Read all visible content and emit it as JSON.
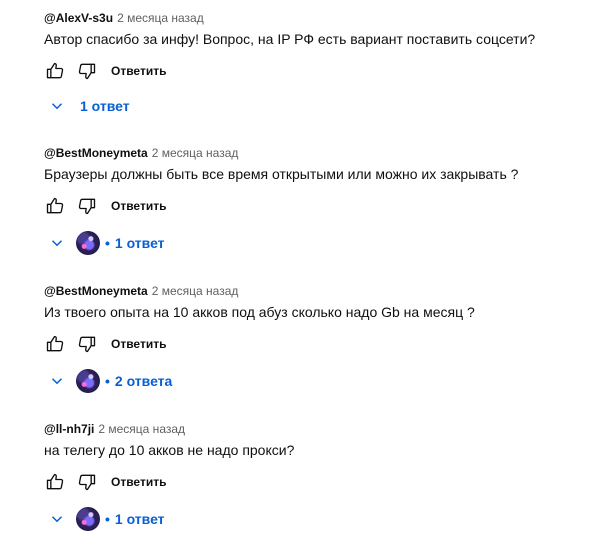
{
  "comments": [
    {
      "author": "@AlexV-s3u",
      "date": "2 месяца назад",
      "text": "Автор спасибо за инфу! Вопрос, на IP РФ есть вариант поставить соцсети?",
      "reply_label": "Ответить",
      "replies_label": "1 ответ",
      "has_avatar": false
    },
    {
      "author": "@BestMoneymeta",
      "date": "2 месяца назад",
      "text": "Браузеры должны быть все время открытыми или можно их закрывать ?",
      "reply_label": "Ответить",
      "replies_label": "1 ответ",
      "has_avatar": true
    },
    {
      "author": "@BestMoneymeta",
      "date": "2 месяца назад",
      "text": "Из твоего опыта на 10 акков под абуз сколько надо  Gb  на месяц ?",
      "reply_label": "Ответить",
      "replies_label": "2 ответа",
      "has_avatar": true
    },
    {
      "author": "@ll-nh7ji",
      "date": "2 месяца назад",
      "text": "на телегу до 10 акков не надо прокси?",
      "reply_label": "Ответить",
      "replies_label": "1 ответ",
      "has_avatar": true
    }
  ],
  "icons": {
    "like": "thumb-up-icon",
    "dislike": "thumb-down-icon",
    "expand": "chevron-down-icon"
  },
  "colors": {
    "link": "#065fd4",
    "meta": "#606060",
    "text": "#0f0f0f"
  }
}
